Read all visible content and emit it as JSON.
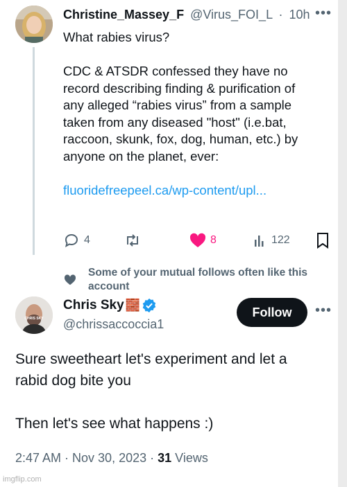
{
  "tweet1": {
    "display_name": "Christine_Massey_F",
    "handle": "@Virus_FOI_L",
    "separator": "·",
    "time": "10h",
    "more_icon": "more-icon",
    "lines": [
      "What rabies virus?",
      "",
      "CDC & ATSDR confessed they have no",
      "record describing finding & purification of",
      "any alleged “rabies virus” from a sample",
      "taken from any diseased \"host\" (i.e.bat,",
      "raccoon, skunk, fox, dog, human, etc.) by",
      "anyone on the planet, ever:",
      ""
    ],
    "link": "fluoridefreepeel.ca/wp-content/upl...",
    "actions": {
      "reply_count": "4",
      "retweet_count": "",
      "like_count": "8",
      "views_count": "122"
    },
    "like_color": "#f91880"
  },
  "social_context": {
    "text": "Some of your mutual follows often like this account"
  },
  "tweet2": {
    "display_name": "Chris Sky",
    "name_emoji": "🧱",
    "handle": "@chrissaccoccia1",
    "avatar_text": "CHRIS SKY",
    "follow_label": "Follow",
    "lines": [
      "Sure sweetheart let's experiment and let a",
      "rabid dog bite you",
      "",
      "Then let's see what happens :)"
    ],
    "time": "2:47 AM · Nov 30, 2023 ·",
    "views_count": "31",
    "views_label": "Views",
    "verified_color": "#1d9bf0"
  },
  "watermark": "imgflip.com"
}
